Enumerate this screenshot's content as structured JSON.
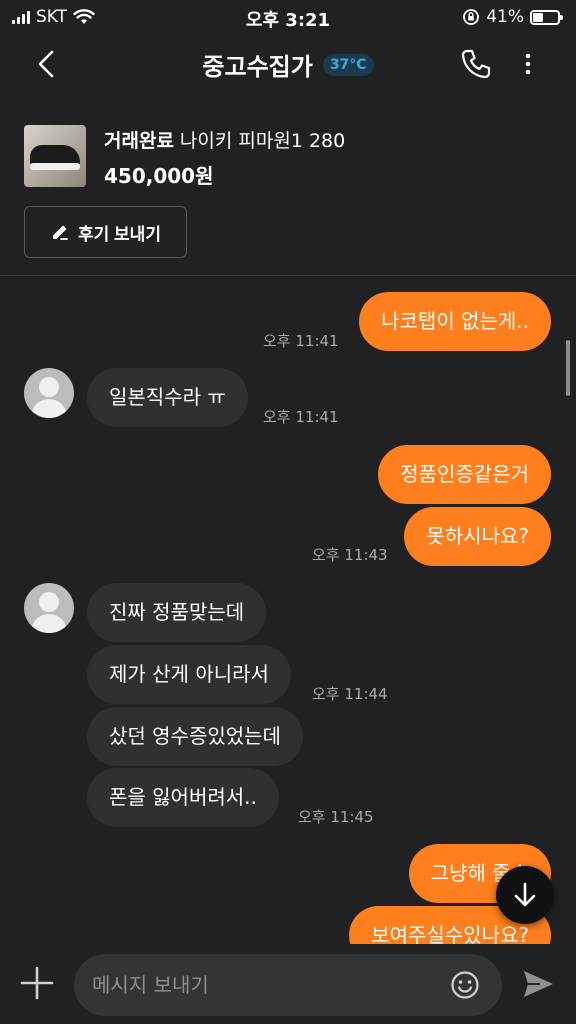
{
  "status_bar": {
    "carrier": "SKT",
    "time": "오후 3:21",
    "battery": "41%",
    "battery_level": 0.41
  },
  "header": {
    "title": "중고수집가",
    "temperature": "37°C",
    "temp_color": "#39a8e0"
  },
  "product": {
    "status": "거래완료",
    "name": "나이키 피마원1 280",
    "price": "450,000원"
  },
  "review_button": {
    "label": "후기 보내기"
  },
  "messages": {
    "m1": {
      "text": "나코탭이 없는게..",
      "time": "오후 11:41"
    },
    "m2": {
      "text": "일본직수라 ㅠ",
      "time": "오후 11:41"
    },
    "m3": {
      "text": "정품인증같은거"
    },
    "m4": {
      "text": "못하시나요?",
      "time": "오후 11:43"
    },
    "m5": {
      "text": "진짜 정품맞는데"
    },
    "m6": {
      "text": "제가 산게 아니라서",
      "time": "오후 11:44"
    },
    "m7": {
      "text": "샀던 영수증있었는데"
    },
    "m8": {
      "text": "폰을 잃어버려서..",
      "time": "오후 11:45"
    },
    "m9": {
      "text": "그냥해 줄수"
    },
    "m10": {
      "text": "보여주실수있나요?"
    }
  },
  "input": {
    "placeholder": "메시지 보내기"
  },
  "colors": {
    "accent": "#ff7e1d",
    "background": "#212123",
    "incoming_bubble": "#2f3033"
  },
  "icons": [
    "back-icon",
    "phone-icon",
    "more-icon",
    "pencil-icon",
    "scroll-down-icon",
    "plus-icon",
    "emoji-icon",
    "send-icon"
  ]
}
